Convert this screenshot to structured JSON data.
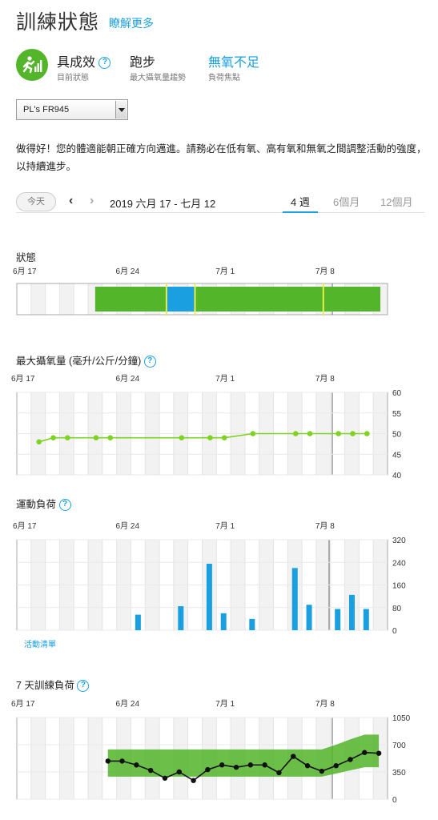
{
  "header": {
    "title": "訓練狀態",
    "learn_more": "瞭解更多"
  },
  "status": {
    "value": "具成效",
    "label": "目前狀態",
    "help": "?",
    "activity": "跑步",
    "activity_label": "最大攝氧量趨勢",
    "focus": "無氧不足",
    "focus_label": "負荷焦點",
    "colors": {
      "productive": "#52b52a",
      "focus": "#1a9fe0"
    }
  },
  "device": {
    "selected": "PL's FR945"
  },
  "message": "做得好！您的體適能朝正確方向邁進。請務必在低有氧、高有氧和無氧之間調整活動的強度，以持續進步。",
  "date_nav": {
    "today": "今天",
    "prev": "‹",
    "next": "›",
    "range": "2019 六月 17 - 七月 12",
    "tabs": [
      "4 週",
      "6個月",
      "12個月"
    ],
    "active_tab": 0
  },
  "sections": {
    "status": "狀態",
    "vo2": "最大攝氧量 (毫升/公斤/分鐘)",
    "load": "運動負荷",
    "activity_list": "活動清單",
    "seven_day": "7 天訓練負荷"
  },
  "chart_data": [
    {
      "type": "bar",
      "title": "狀態",
      "x_ticks": [
        "6月 17",
        "6月 24",
        "7月 1",
        "7月 8"
      ],
      "segments": [
        {
          "start": 6,
          "end": 11,
          "status": "productive",
          "color": "#52b52a"
        },
        {
          "start": 11,
          "end": 13,
          "status": "peaking",
          "color": "#1a9fe0"
        },
        {
          "start": 13,
          "end": 26,
          "status": "productive",
          "color": "#52b52a"
        }
      ],
      "markers": [
        11,
        13,
        22
      ],
      "grid": true
    },
    {
      "type": "line",
      "title": "最大攝氧量 (毫升/公斤/分鐘)",
      "x_ticks": [
        "6月 17",
        "6月 24",
        "7月 1",
        "7月 8"
      ],
      "y_ticks": [
        60,
        55,
        50,
        45,
        40
      ],
      "ylim": [
        40,
        60
      ],
      "x": [
        1,
        2,
        3,
        5,
        6,
        11,
        13,
        14,
        16,
        19,
        20,
        22,
        23,
        24
      ],
      "values": [
        48,
        49,
        49,
        49,
        49,
        49,
        49,
        49,
        50,
        50,
        50,
        50,
        50,
        50
      ],
      "color": "#7ed321",
      "grid": true
    },
    {
      "type": "bar",
      "title": "運動負荷",
      "x_ticks": [
        "6月 17",
        "6月 24",
        "7月 1",
        "7月 8"
      ],
      "y_ticks": [
        320,
        240,
        160,
        80,
        0
      ],
      "ylim": [
        0,
        320
      ],
      "x": [
        8,
        11,
        13,
        14,
        16,
        19,
        20,
        22,
        23,
        24
      ],
      "values": [
        55,
        85,
        235,
        60,
        40,
        220,
        90,
        75,
        125,
        75
      ],
      "color": "#1a9fe0",
      "grid": true
    },
    {
      "type": "line",
      "title": "7 天訓練負荷",
      "x_ticks": [
        "6月 17",
        "6月 24",
        "7月 1",
        "7月 8"
      ],
      "y_ticks": [
        1050,
        700,
        350,
        0
      ],
      "ylim": [
        0,
        1050
      ],
      "x": [
        6,
        7,
        8,
        9,
        10,
        11,
        12,
        13,
        14,
        15,
        16,
        17,
        18,
        19,
        20,
        21,
        22,
        23,
        24,
        25
      ],
      "values": [
        490,
        490,
        440,
        370,
        270,
        350,
        240,
        380,
        440,
        410,
        440,
        440,
        340,
        550,
        430,
        360,
        430,
        510,
        600,
        590
      ],
      "band_low": [
        290,
        290,
        290,
        290,
        290,
        290,
        290,
        290,
        290,
        290,
        290,
        290,
        290,
        290,
        290,
        290,
        330,
        370,
        410,
        410
      ],
      "band_high": [
        640,
        640,
        640,
        640,
        640,
        640,
        640,
        640,
        640,
        640,
        640,
        640,
        640,
        640,
        640,
        640,
        700,
        770,
        830,
        830
      ],
      "line_color": "#111111",
      "band_color": "#52b52a",
      "grid": true
    }
  ]
}
